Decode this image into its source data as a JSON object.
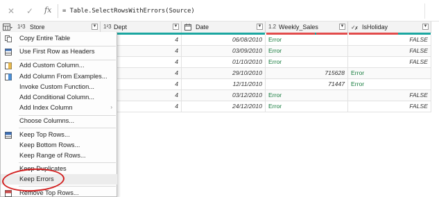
{
  "formula_bar": {
    "cancel_icon": "x-icon",
    "commit_icon": "check-icon",
    "fx_label": "fx",
    "formula": "= Table.SelectRowsWithErrors(Source)"
  },
  "columns": [
    {
      "type": "1²3",
      "name": "Store"
    },
    {
      "type": "1²3",
      "name": "Dept"
    },
    {
      "type": "calendar-icon",
      "name": "Date"
    },
    {
      "type": "1.2",
      "name": "Weekly_Sales"
    },
    {
      "type": "Aᵇc",
      "name": "IsHoliday"
    }
  ],
  "rows": [
    {
      "dept": "4",
      "date": "06/08/2010",
      "weekly_sales": "Error",
      "isholiday": "FALSE"
    },
    {
      "dept": "4",
      "date": "03/09/2010",
      "weekly_sales": "Error",
      "isholiday": "FALSE"
    },
    {
      "dept": "4",
      "date": "01/10/2010",
      "weekly_sales": "Error",
      "isholiday": "FALSE"
    },
    {
      "dept": "4",
      "date": "29/10/2010",
      "weekly_sales": "715628",
      "isholiday": "Error"
    },
    {
      "dept": "4",
      "date": "12/11/2010",
      "weekly_sales": "71447",
      "isholiday": "Error"
    },
    {
      "dept": "4",
      "date": "03/12/2010",
      "weekly_sales": "Error",
      "isholiday": "FALSE"
    },
    {
      "dept": "4",
      "date": "24/12/2010",
      "weekly_sales": "Error",
      "isholiday": "FALSE"
    }
  ],
  "menu": {
    "items": [
      {
        "label": "Copy Entire Table",
        "icon": "copy-icon"
      },
      {
        "label": "Use First Row as Headers",
        "icon": "table-header-icon"
      },
      {
        "label": "Add Custom Column...",
        "icon": "custom-column-icon"
      },
      {
        "label": "Add Column From Examples...",
        "icon": "column-examples-icon"
      },
      {
        "label": "Invoke Custom Function...",
        "icon": ""
      },
      {
        "label": "Add Conditional Column...",
        "icon": ""
      },
      {
        "label": "Add Index Column",
        "icon": "",
        "submenu": "›"
      },
      {
        "label": "Choose Columns...",
        "icon": ""
      },
      {
        "label": "Keep Top Rows...",
        "icon": "keep-rows-icon"
      },
      {
        "label": "Keep Bottom Rows...",
        "icon": ""
      },
      {
        "label": "Keep Range of Rows...",
        "icon": ""
      },
      {
        "label": "Keep Duplicates",
        "icon": ""
      },
      {
        "label": "Keep Errors",
        "icon": ""
      },
      {
        "label": "Remove Top Rows...",
        "icon": "remove-rows-icon"
      }
    ]
  },
  "colors": {
    "error_text": "#137a3b",
    "quality_valid": "#1aa6a0",
    "quality_error": "#e24b4b",
    "annotation": "#d21f1f"
  }
}
